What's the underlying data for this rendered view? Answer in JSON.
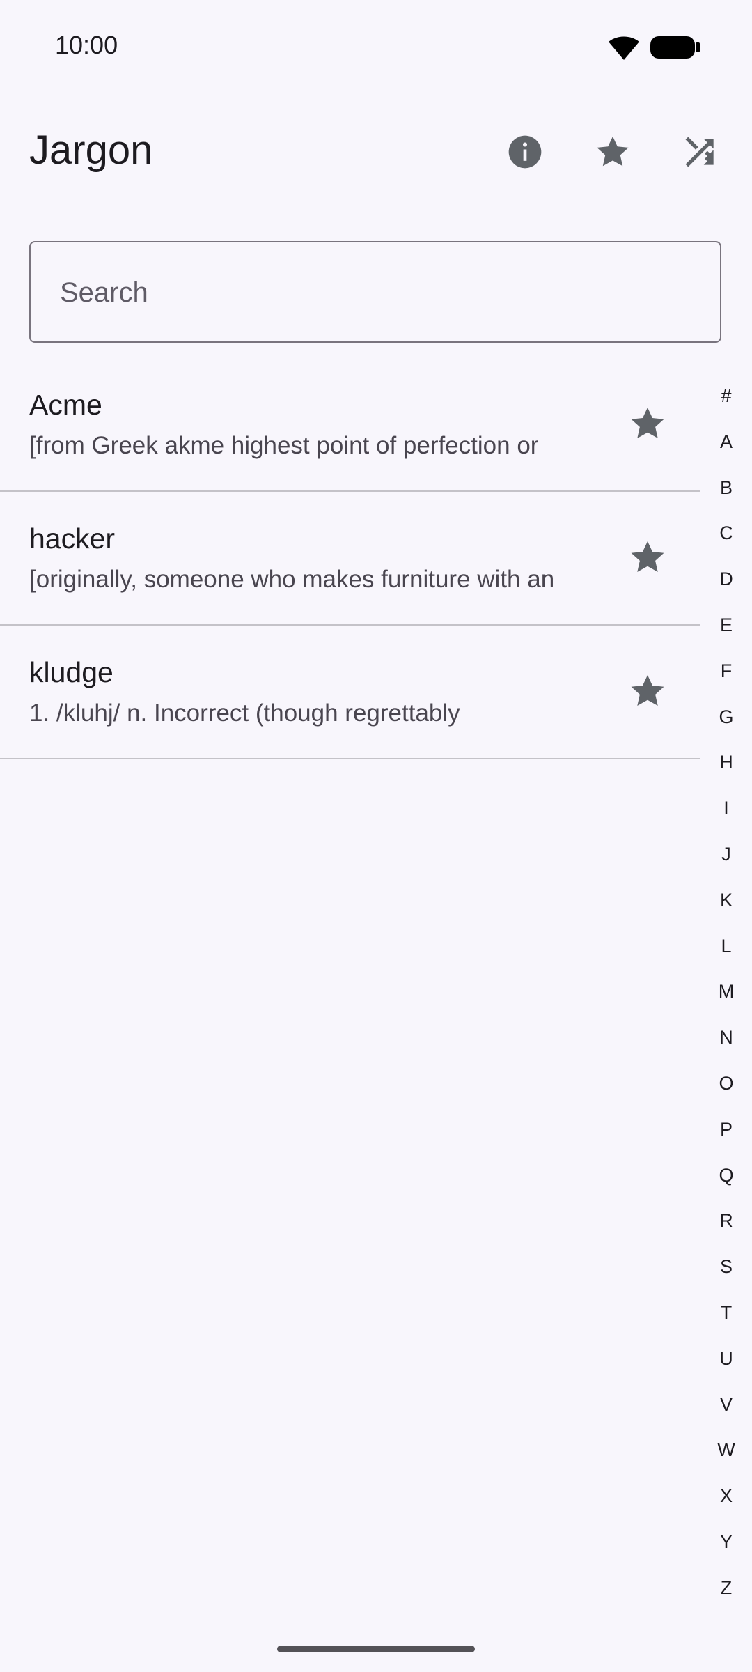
{
  "status_bar": {
    "time": "10:00",
    "wifi_icon": "wifi-icon",
    "battery_icon": "battery-icon"
  },
  "app_bar": {
    "title": "Jargon",
    "actions": [
      {
        "icon": "info-icon",
        "label": "Info"
      },
      {
        "icon": "star-icon",
        "label": "Favorites"
      },
      {
        "icon": "shuffle-icon",
        "label": "Random"
      }
    ]
  },
  "search": {
    "placeholder": "Search",
    "value": ""
  },
  "terms": [
    {
      "title": "Acme",
      "description": "[from Greek akme highest point of perfection or",
      "starred": true
    },
    {
      "title": "hacker",
      "description": "[originally, someone who makes furniture with an",
      "starred": true
    },
    {
      "title": "kludge",
      "description": "1. /kluhj/ n. Incorrect (though regrettably",
      "starred": true
    }
  ],
  "alphabet_index": [
    "#",
    "A",
    "B",
    "C",
    "D",
    "E",
    "F",
    "G",
    "H",
    "I",
    "J",
    "K",
    "L",
    "M",
    "N",
    "O",
    "P",
    "Q",
    "R",
    "S",
    "T",
    "U",
    "V",
    "W",
    "X",
    "Y",
    "Z"
  ],
  "colors": {
    "background": "#f8f6fc",
    "icon": "#5f6368",
    "divider": "#c4c2c8",
    "outline": "#79747e"
  }
}
